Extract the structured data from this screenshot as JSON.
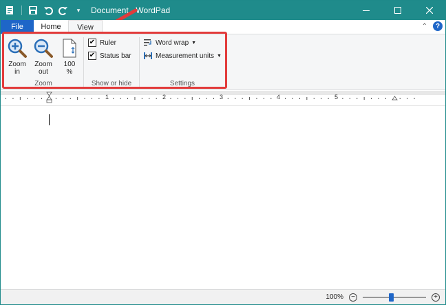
{
  "title_bar": {
    "title": "Document - WordPad",
    "qat_icons": [
      "wordpad-icon",
      "save-icon",
      "undo-icon",
      "redo-icon",
      "customize-icon"
    ],
    "window_controls": [
      "minimize",
      "maximize",
      "close"
    ]
  },
  "tabs": [
    {
      "label": "File",
      "color": "#1e66c8"
    },
    {
      "label": "Home"
    },
    {
      "label": "View",
      "active": true
    }
  ],
  "ribbon": {
    "zoom": {
      "label": "Zoom",
      "zoom_in": "Zoom in",
      "zoom_out": "Zoom out",
      "hundred": "100 %"
    },
    "show_hide": {
      "label": "Show or hide",
      "ruler": {
        "label": "Ruler",
        "checked": true
      },
      "status_bar": {
        "label": "Status bar",
        "checked": true
      }
    },
    "settings": {
      "label": "Settings",
      "word_wrap": "Word wrap",
      "measurement_units": "Measurement units"
    }
  },
  "ruler": {
    "numbers": [
      "1",
      "2",
      "3",
      "4",
      "5"
    ]
  },
  "status_bar": {
    "zoom_value": "100%",
    "zoom_minus": "−",
    "zoom_plus": "+",
    "slider_position": 0.45
  },
  "colors": {
    "title_bar": "#1f8b8b",
    "accent": "#1e66c8",
    "highlight": "#e23b3b"
  }
}
